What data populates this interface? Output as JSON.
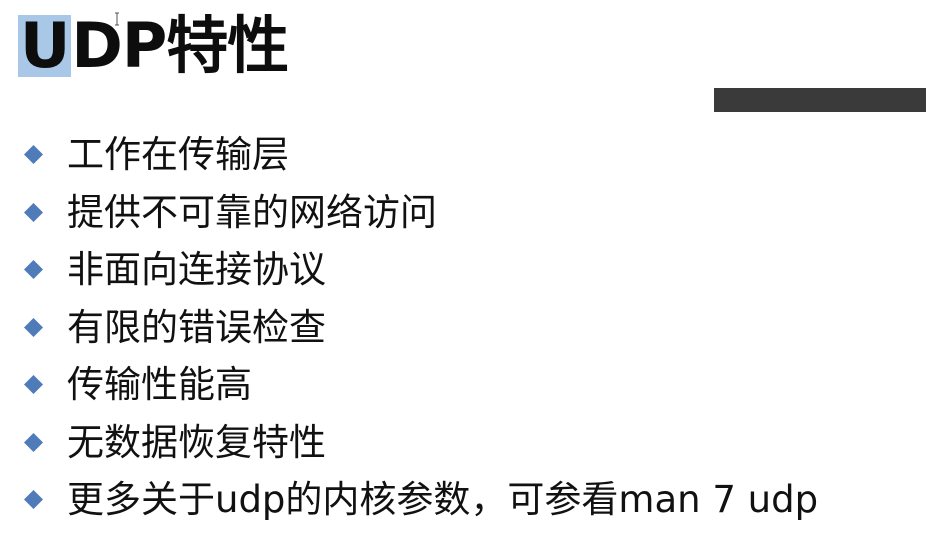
{
  "slide": {
    "title": {
      "selected_part": "U",
      "rest": "DP特性"
    },
    "bullet_icon": "diamond-bullet-icon",
    "bullets": [
      "工作在传输层",
      "提供不可靠的网络访问",
      "非面向连接协议",
      "有限的错误检查",
      "传输性能高",
      "无数据恢复特性",
      "更多关于udp的内核参数，可参看man 7 udp"
    ]
  },
  "colors": {
    "bullet": "#4f7cb8",
    "selection_highlight": "#a9c7e6",
    "dark_bar": "#3a3a3a",
    "text": "#111111"
  }
}
